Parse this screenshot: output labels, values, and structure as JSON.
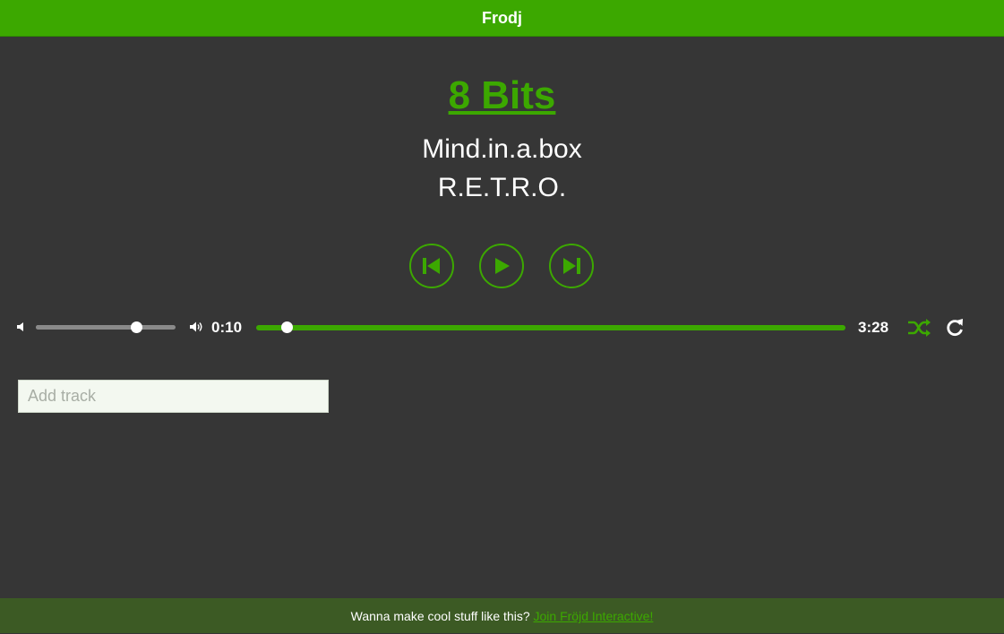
{
  "header": {
    "title": "Frodj"
  },
  "now_playing": {
    "title": "8 Bits",
    "artist": "Mind.in.a.box",
    "album": "R.E.T.R.O."
  },
  "controls": {
    "previous_icon": "skip-previous-icon",
    "play_icon": "play-icon",
    "next_icon": "skip-next-icon"
  },
  "volume": {
    "low_icon": "volume-low-icon",
    "high_icon": "volume-high-icon",
    "level": 0.72
  },
  "progress": {
    "current_time": "0:10",
    "total_time": "3:28",
    "fraction": 0.052
  },
  "modes": {
    "shuffle_icon": "shuffle-icon",
    "shuffle_active": true,
    "repeat_icon": "repeat-icon",
    "repeat_active": false
  },
  "add_track": {
    "placeholder": "Add track",
    "value": ""
  },
  "footer": {
    "text": "Wanna make cool stuff like this? ",
    "link_text": "Join Fröjd Interactive!"
  },
  "colors": {
    "accent": "#3ca800",
    "background": "#363636",
    "footer_background": "#3c5a24",
    "text": "#ffffff"
  }
}
